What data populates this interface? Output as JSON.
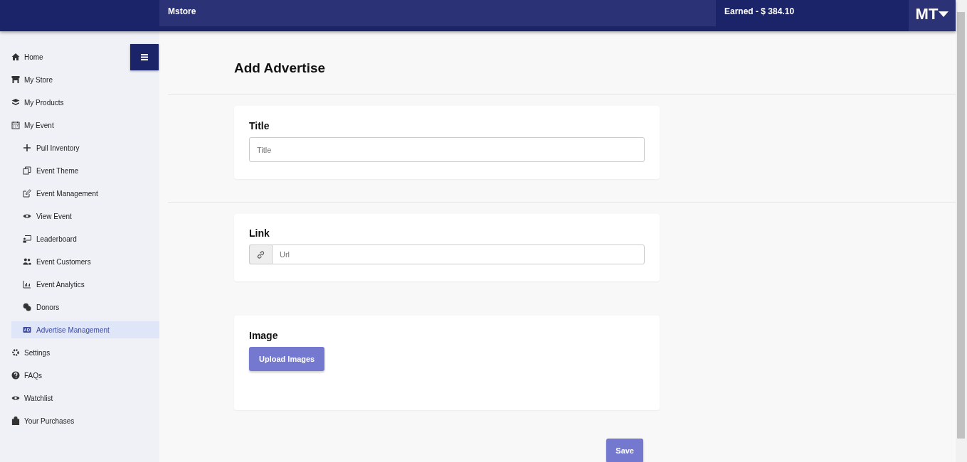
{
  "header": {
    "store_name": "Mstore",
    "earned": "Earned - $ 384.10",
    "user_initials": "MT"
  },
  "sidebar": {
    "items": [
      {
        "label": "Home",
        "selected": false
      },
      {
        "label": "My Store",
        "selected": false
      },
      {
        "label": "My Products",
        "selected": false
      },
      {
        "label": "My Event",
        "selected": false,
        "children": [
          {
            "label": "Pull Inventory",
            "selected": false
          },
          {
            "label": "Event Theme",
            "selected": false
          },
          {
            "label": "Event Management",
            "selected": false
          },
          {
            "label": "View Event",
            "selected": false
          },
          {
            "label": "Leaderboard",
            "selected": false
          },
          {
            "label": "Event Customers",
            "selected": false
          },
          {
            "label": "Event Analytics",
            "selected": false
          },
          {
            "label": "Donors",
            "selected": false
          },
          {
            "label": "Advertise Management",
            "selected": true
          }
        ]
      },
      {
        "label": "Settings",
        "selected": false
      },
      {
        "label": "FAQs",
        "selected": false
      },
      {
        "label": "Watchlist",
        "selected": false
      },
      {
        "label": "Your Purchases",
        "selected": false
      }
    ]
  },
  "page": {
    "title": "Add Advertise",
    "sections": [
      {
        "kind": "text",
        "label": "Title",
        "placeholder": "Title"
      },
      {
        "kind": "link",
        "label": "Link",
        "placeholder": "Url"
      },
      {
        "kind": "upload",
        "label": "Image",
        "button": "Upload Images"
      }
    ],
    "save_button": "Save"
  }
}
